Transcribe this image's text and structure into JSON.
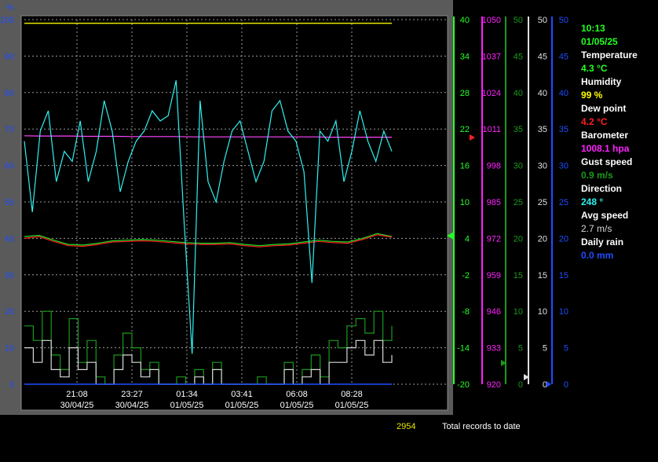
{
  "chart_data": {
    "type": "line",
    "y_unit_label": "%",
    "axes": [
      {
        "name": "percent",
        "color": "#1e4dff",
        "ticks": [
          "100",
          "90",
          "80",
          "70",
          "60",
          "50",
          "40",
          "30",
          "20",
          "10",
          "0"
        ]
      },
      {
        "name": "temperature",
        "color": "#22ff22",
        "ticks": [
          "40",
          "34",
          "28",
          "22",
          "16",
          "10",
          "4",
          "-2",
          "-8",
          "-14",
          "-20"
        ]
      },
      {
        "name": "barometer",
        "color": "#ff22ff",
        "ticks": [
          "1050",
          "1037",
          "1024",
          "1011",
          "998",
          "985",
          "972",
          "959",
          "946",
          "933",
          "920"
        ]
      },
      {
        "name": "gust",
        "color": "#1a9a1a",
        "ticks": [
          "50",
          "45",
          "40",
          "35",
          "30",
          "25",
          "20",
          "15",
          "10",
          "5",
          "0"
        ]
      },
      {
        "name": "avg-speed",
        "color": "#e0e0e0",
        "ticks": [
          "50",
          "45",
          "40",
          "35",
          "30",
          "25",
          "20",
          "15",
          "10",
          "5",
          "0"
        ]
      },
      {
        "name": "rain",
        "color": "#1e4dff",
        "ticks": [
          "50",
          "45",
          "40",
          "35",
          "30",
          "25",
          "20",
          "15",
          "10",
          "5",
          "0"
        ]
      }
    ],
    "x_ticks": [
      {
        "time": "21:08",
        "date": "30/04/25"
      },
      {
        "time": "23:27",
        "date": "30/04/25"
      },
      {
        "time": "01:34",
        "date": "01/05/25"
      },
      {
        "time": "03:41",
        "date": "01/05/25"
      },
      {
        "time": "06:08",
        "date": "01/05/25"
      },
      {
        "time": "08:28",
        "date": "01/05/25"
      }
    ],
    "series": [
      {
        "key": "humidity",
        "color": "#e8e800",
        "axis": "percent",
        "values": [
          99,
          99,
          99,
          99,
          99,
          99,
          99,
          99,
          99,
          99,
          99,
          99,
          99,
          99,
          99,
          99,
          99,
          99,
          99,
          99,
          99,
          99,
          99,
          99,
          99
        ]
      },
      {
        "key": "barometer",
        "color": "#ff44ff",
        "axis": "barometer",
        "values": [
          1008.6,
          1008.5,
          1008.5,
          1008.5,
          1008.4,
          1008.4,
          1008.4,
          1008.3,
          1008.3,
          1008.3,
          1008.3,
          1008.2,
          1008.2,
          1008.2,
          1008.2,
          1008.2,
          1008.2,
          1008.2,
          1008.2,
          1008.2,
          1008.1,
          1008.1,
          1008.1,
          1008.1,
          1008.1
        ]
      },
      {
        "key": "temperature",
        "color": "#20e020",
        "axis": "temperature",
        "values": [
          4.3,
          4.5,
          3.7,
          3.0,
          2.9,
          3.2,
          3.6,
          3.7,
          3.8,
          3.7,
          3.5,
          3.3,
          3.2,
          3.2,
          3.3,
          3.0,
          2.8,
          3.0,
          3.1,
          3.4,
          3.7,
          3.5,
          3.4,
          4.0,
          4.8,
          4.3
        ]
      },
      {
        "key": "dew-point",
        "color": "#ff2020",
        "axis": "temperature",
        "values": [
          4.0,
          4.3,
          3.5,
          2.8,
          2.7,
          3.0,
          3.4,
          3.5,
          3.6,
          3.5,
          3.3,
          3.1,
          3.0,
          3.0,
          3.1,
          2.8,
          2.6,
          2.8,
          2.9,
          3.2,
          3.5,
          3.3,
          3.2,
          3.8,
          4.6,
          4.2
        ]
      },
      {
        "key": "direction",
        "color": "#30f0f0",
        "axis": "percent-as-0-360",
        "values": [
          240,
          170,
          250,
          270,
          200,
          230,
          220,
          260,
          200,
          230,
          280,
          250,
          190,
          220,
          240,
          250,
          270,
          260,
          265,
          300,
          160,
          30,
          280,
          200,
          180,
          220,
          250,
          260,
          230,
          200,
          220,
          270,
          280,
          250,
          240,
          210,
          100,
          250,
          240,
          260,
          200,
          230,
          270,
          240,
          220,
          250,
          230
        ]
      },
      {
        "key": "gust",
        "color": "#1a9a1a",
        "axis": "gust",
        "values": [
          8,
          6,
          10,
          4,
          2,
          9,
          3,
          6,
          1,
          0,
          4,
          7,
          5,
          2,
          3,
          0,
          0,
          1,
          0,
          2,
          0,
          3,
          0,
          0,
          0,
          0,
          1,
          0,
          0,
          3,
          0,
          2,
          4,
          1,
          6,
          5,
          8,
          9,
          7,
          10,
          6,
          8
        ]
      },
      {
        "key": "avg-speed",
        "color": "#d8d8d8",
        "axis": "avg-speed",
        "values": [
          5,
          3,
          6,
          2,
          1,
          5,
          2,
          3,
          0,
          0,
          2,
          4,
          3,
          1,
          2,
          0,
          0,
          0,
          0,
          1,
          0,
          2,
          0,
          0,
          0,
          0,
          0,
          0,
          0,
          2,
          0,
          1,
          2,
          0,
          3,
          3,
          5,
          6,
          4,
          6,
          3,
          4
        ]
      },
      {
        "key": "rain",
        "color": "#1e4dff",
        "axis": "rain",
        "values": [
          0,
          0,
          0,
          0,
          0,
          0,
          0,
          0,
          0,
          0,
          0,
          0
        ]
      }
    ]
  },
  "readout": {
    "time": "10:13",
    "date": "01/05/25",
    "temperature_label": "Temperature",
    "temperature_value": "4.3 °C",
    "humidity_label": "Humidity",
    "humidity_value": "99 %",
    "dewpoint_label": "Dew point",
    "dewpoint_value": "4.2 °C",
    "barometer_label": "Barometer",
    "barometer_value": "1008.1 hpa",
    "gust_label": "Gust speed",
    "gust_value": "0.9 m/s",
    "direction_label": "Direction",
    "direction_value": "248 °",
    "avgspeed_label": "Avg speed",
    "avgspeed_value": "2.7 m/s",
    "rain_label": "Daily rain",
    "rain_value": "0.0 mm"
  },
  "footer": {
    "records": "2954",
    "records_label": "Total records to date"
  },
  "colors": {
    "frame": "#555555",
    "plot_bg": "#000000",
    "grid": "#b0b0b0",
    "label_white": "#ffffff",
    "label_green": "#22ff22",
    "label_yellow": "#ffff00",
    "label_red": "#ff2020",
    "label_magenta": "#ff22ff",
    "label_darkgreen": "#1a9a1a",
    "label_cyan": "#30f0f0",
    "label_gray": "#d8d8d8",
    "label_blue": "#1e4dff",
    "footer_yellow": "#e8e800"
  }
}
